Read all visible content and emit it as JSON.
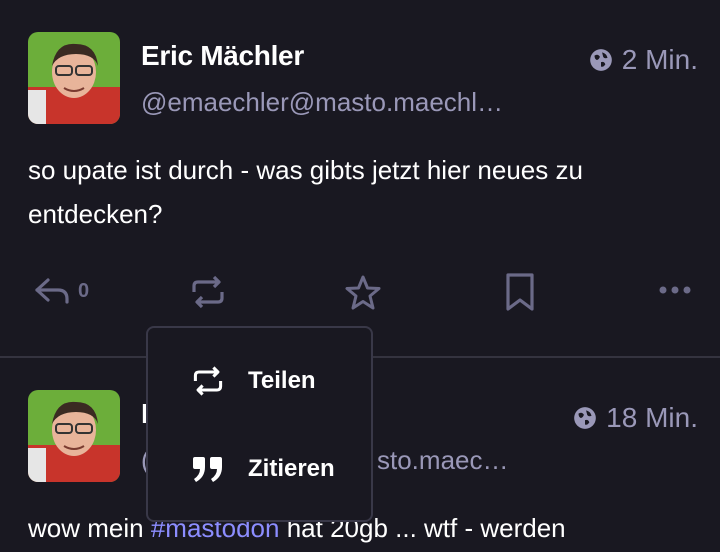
{
  "posts": [
    {
      "author": "Eric Mächler",
      "handle": "@emaechler@masto.maechl…",
      "time": "2 Min.",
      "content": "so upate ist durch - was gibts jetzt hier neues  zu entdecken?",
      "reply_count": "0"
    },
    {
      "author_visible": "I",
      "handle_visible": "(",
      "handle_tail": "sto.maec…",
      "time": "18 Min.",
      "content_before": "wow mein ",
      "hashtag": "#mastodon",
      "content_after": " hat 20gb ... wtf - werden"
    }
  ],
  "boost_menu": {
    "items": [
      {
        "label": "Teilen",
        "icon": "boost-icon"
      },
      {
        "label": "Zitieren",
        "icon": "quote-icon"
      }
    ]
  },
  "colors": {
    "background": "#191821",
    "muted": "#9a98b8",
    "icon": "#6b6a88",
    "hashtag": "#8c8dff"
  }
}
